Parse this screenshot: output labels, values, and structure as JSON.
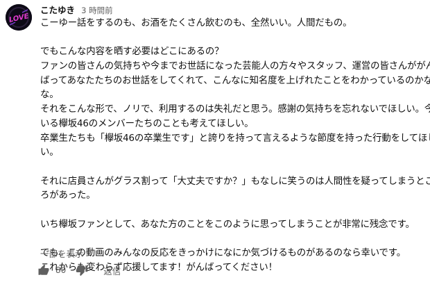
{
  "comment": {
    "author": "こたゆき",
    "time": "3 時間前",
    "avatar_text": "LOVE",
    "lines": [
      "こーゆー話をするのも、お酒をたくさん飲むのも、全然いい。人間だもの。",
      "",
      "でもこんな内容を晒す必要はどこにあるの？",
      "ファンの皆さんの気持ちや今までお世話になった芸能人の方々やスタッフ、運営の皆さんががん",
      "ばってあなたたちのお世話をしてくれて、こんなに知名度を上げれたことをわかっているのかな",
      "な。",
      "それをこんな形で、ノリで、利用するのは失礼だと思う。感謝の気持ちを忘れないでほしい。今",
      "いる欅坂46のメンバーたちのことも考えてほしい。",
      "卒業生たちも「欅坂46の卒業生です」と誇りを持って言えるような節度を持った行動をしてほし",
      "い。",
      "",
      "それに店員さんがグラス割って「大丈夫ですか？」もなしに笑うのは人間性を疑ってしまうとこ",
      "ろがあった。",
      "",
      "いち欅坂ファンとして、あなた方のことをこのように思ってしまうことが非常に残念です。",
      "",
      "でも、この動画のみんなの反応をきっかけになにか気づけるものがあるのなら幸いです。",
      "これからも変わらず応援してます！がんばってください！"
    ],
    "read_more": "一部を表示",
    "like_count": "80",
    "reply_label": "返信"
  },
  "icons": {
    "like": "thumbs-up-icon",
    "dislike": "thumbs-down-icon"
  },
  "colors": {
    "text": "#0f0f0f",
    "secondary": "#606060",
    "avatar_bg": "#0d0a16",
    "avatar_accent": "#e23bd0"
  }
}
